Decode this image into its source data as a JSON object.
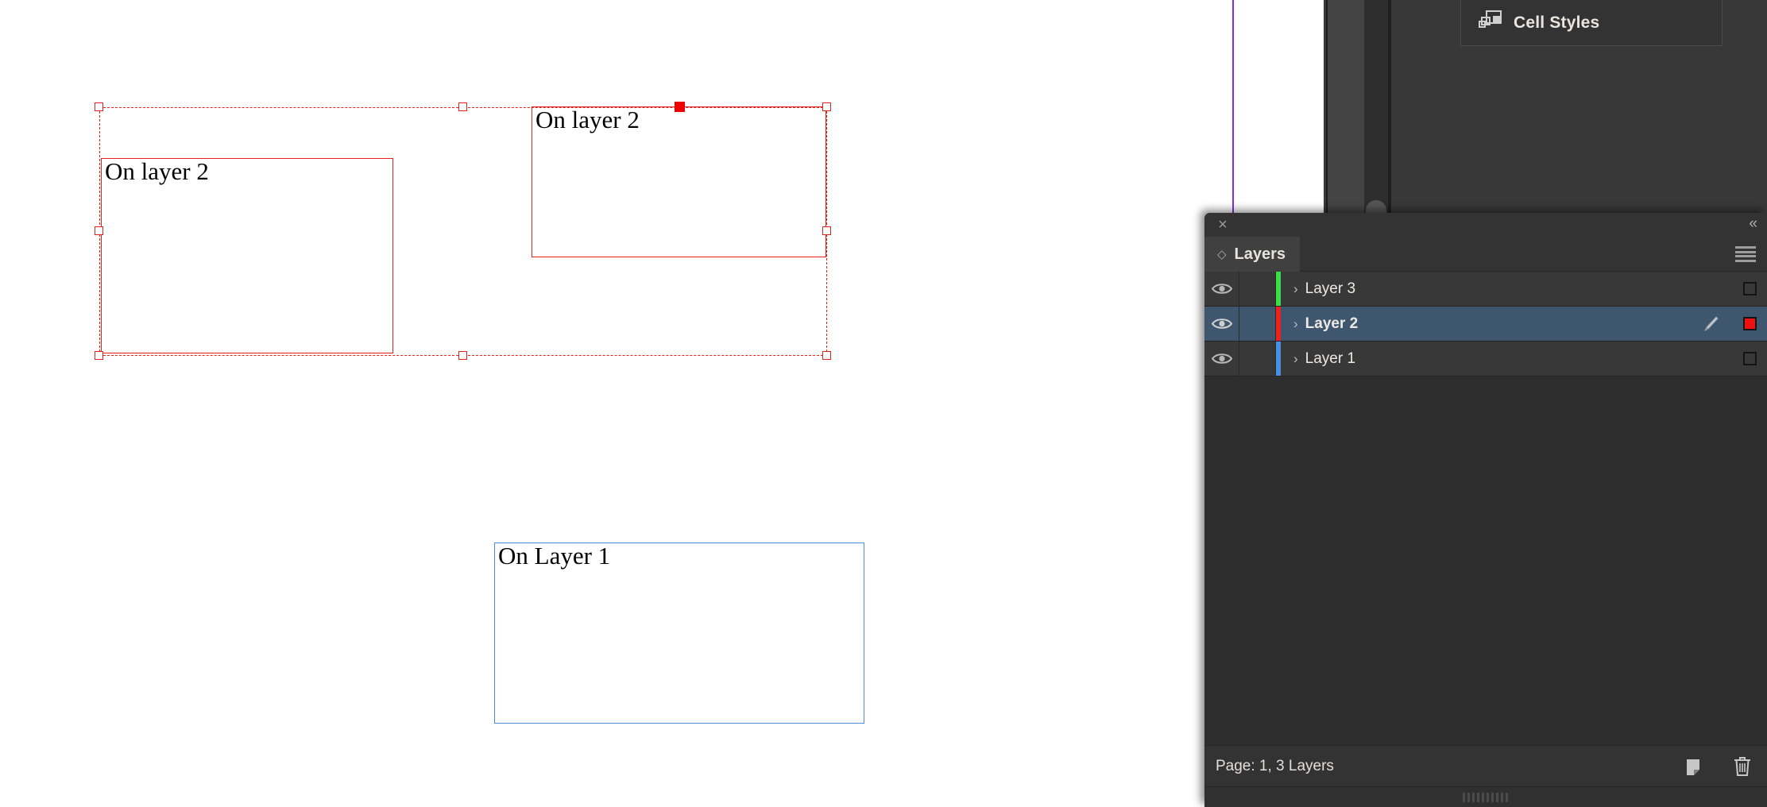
{
  "app": {
    "canvas_background": "#ffffff",
    "selection_color": "#e8201c",
    "layer1_frame_color": "#4a90d9",
    "guide_color": "#8a2be2"
  },
  "canvas": {
    "guide": {
      "label": "vertical-guide"
    },
    "frames": [
      {
        "id": "frame-left-layer2",
        "text": "On layer 2",
        "stroke": "#e8201c"
      },
      {
        "id": "frame-right-layer2",
        "text": "On layer 2",
        "stroke": "#e8201c"
      },
      {
        "id": "frame-layer1",
        "text": "On Layer 1",
        "stroke": "#4a90d9"
      }
    ],
    "selection": {
      "handles": 8,
      "reference_point": "top-center"
    }
  },
  "cell_styles_panel": {
    "label": "Cell Styles",
    "icon": "cell-styles-icon"
  },
  "layers_panel": {
    "titlebar": {
      "close_label": "×",
      "collapse_label": "«"
    },
    "tab": {
      "diamond": "◇",
      "name": "Layers"
    },
    "menu_icon": "panel-menu-icon",
    "columns": [
      "visibility",
      "lock",
      "color",
      "name",
      "pen",
      "target"
    ],
    "rows": [
      {
        "name": "Layer 3",
        "color": "#3ddc4a",
        "visible": true,
        "locked": false,
        "selected": false,
        "has_pen": false,
        "target_filled": false,
        "chevron": "›"
      },
      {
        "name": "Layer 2",
        "color": "#ee2020",
        "visible": true,
        "locked": false,
        "selected": true,
        "has_pen": true,
        "target_filled": true,
        "chevron": "›"
      },
      {
        "name": "Layer 1",
        "color": "#4a90e2",
        "visible": true,
        "locked": false,
        "selected": false,
        "has_pen": false,
        "target_filled": false,
        "chevron": "›"
      }
    ],
    "footer": {
      "status": "Page: 1, 3 Layers",
      "new_layer_icon": "new-layer-icon",
      "delete_layer_icon": "trash-icon"
    },
    "grip": "resize-grip"
  }
}
